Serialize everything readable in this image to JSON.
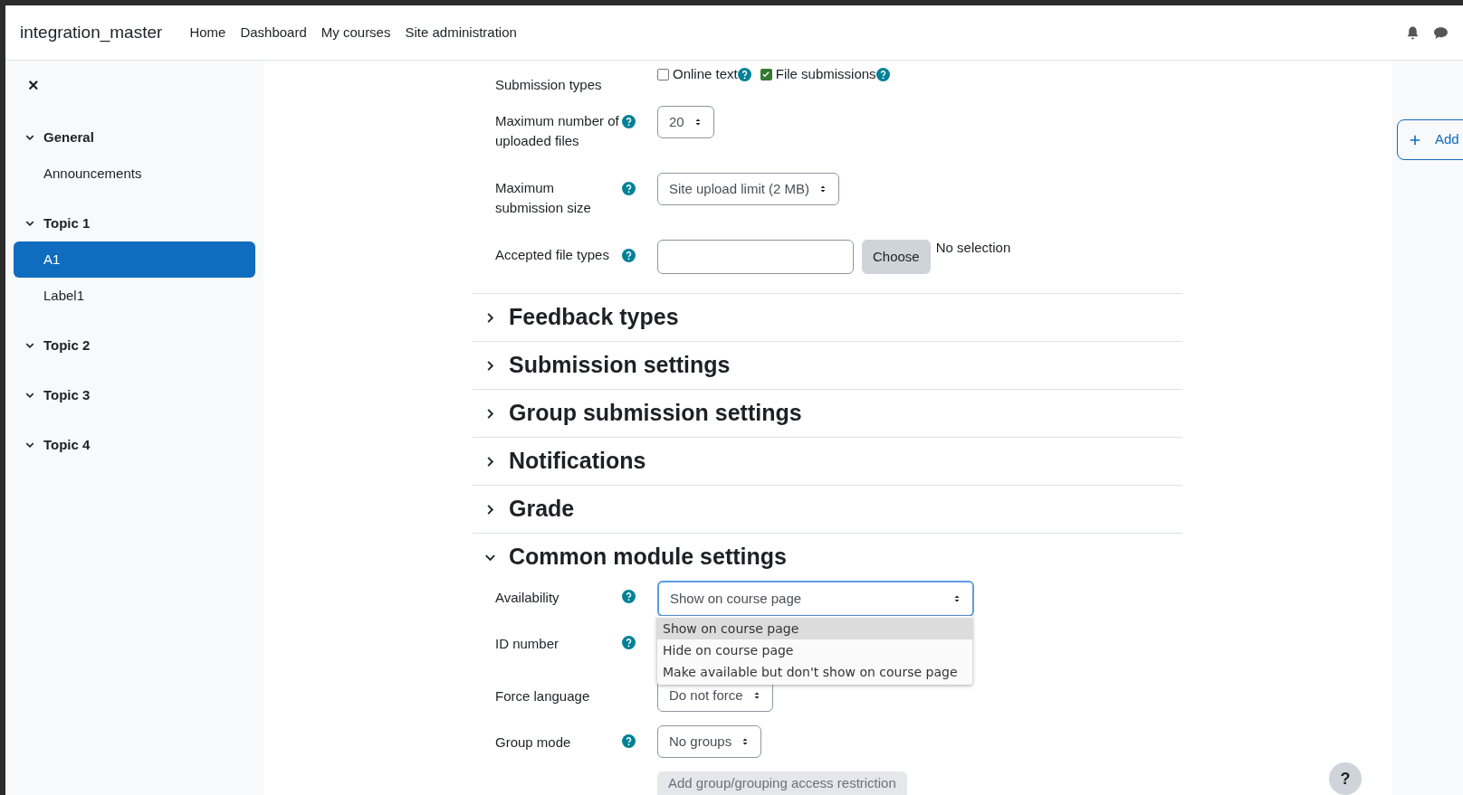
{
  "navbar": {
    "brand": "integration_master",
    "links": [
      "Home",
      "Dashboard",
      "My courses",
      "Site administration"
    ]
  },
  "sidebar": {
    "close": "×",
    "sections": [
      {
        "title": "General",
        "expanded": true,
        "items": [
          {
            "label": "Announcements",
            "selected": false
          }
        ]
      },
      {
        "title": "Topic 1",
        "expanded": true,
        "items": [
          {
            "label": "A1",
            "selected": true
          },
          {
            "label": "Label1",
            "selected": false
          }
        ]
      },
      {
        "title": "Topic 2",
        "expanded": true
      },
      {
        "title": "Topic 3",
        "expanded": true
      },
      {
        "title": "Topic 4",
        "expanded": true
      }
    ]
  },
  "form": {
    "rows": [
      {
        "kind": "checkboxes",
        "label": "Submission types",
        "help": false,
        "options": [
          {
            "label": "Online text",
            "checked": false,
            "help": true
          },
          {
            "label": "File submissions",
            "checked": true,
            "help": true
          }
        ]
      },
      {
        "kind": "select",
        "label": "Maximum number of uploaded files",
        "help": true,
        "value": "20"
      },
      {
        "kind": "select",
        "label": "Maximum submission size",
        "help": true,
        "value": "Site upload limit (2 MB)"
      },
      {
        "kind": "filetypes",
        "label": "Accepted file types",
        "help": true,
        "button": "Choose",
        "note": "No selection"
      }
    ],
    "sections": [
      {
        "title": "Feedback types",
        "expanded": false
      },
      {
        "title": "Submission settings",
        "expanded": false
      },
      {
        "title": "Group submission settings",
        "expanded": false
      },
      {
        "title": "Notifications",
        "expanded": false
      },
      {
        "title": "Grade",
        "expanded": false
      },
      {
        "title": "Common module settings",
        "expanded": true,
        "rows": [
          {
            "kind": "select",
            "label": "Availability",
            "help": true,
            "value": "Show on course page",
            "open": true,
            "options": [
              {
                "label": "Show on course page",
                "selected": true
              },
              {
                "label": "Hide on course page",
                "selected": false
              },
              {
                "label": "Make available but don't show on course page",
                "selected": false
              }
            ]
          },
          {
            "kind": "covered",
            "label": "ID number",
            "help": true
          },
          {
            "kind": "select",
            "label": "Force language",
            "help": false,
            "value": "Do not force"
          },
          {
            "kind": "select",
            "label": "Group mode",
            "help": true,
            "value": "No groups"
          },
          {
            "kind": "button",
            "label": "Add group/grouping access restriction",
            "disabled": true
          }
        ]
      }
    ]
  },
  "drawer": {
    "add": "Add"
  },
  "help_button": "?"
}
